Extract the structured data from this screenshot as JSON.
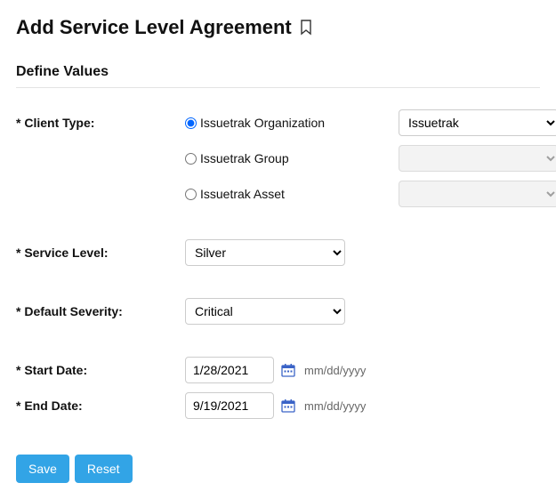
{
  "page": {
    "title": "Add Service Level Agreement"
  },
  "section": {
    "title": "Define Values"
  },
  "labels": {
    "client_type": "* Client Type:",
    "service_level": "* Service Level:",
    "default_severity": "* Default Severity:",
    "start_date": "* Start Date:",
    "end_date": "* End Date:"
  },
  "client_type": {
    "options": {
      "org": "Issuetrak Organization",
      "group": "Issuetrak Group",
      "asset": "Issuetrak Asset"
    },
    "org_select_value": "Issuetrak",
    "group_select_value": "",
    "asset_select_value": ""
  },
  "service_level": {
    "value": "Silver"
  },
  "default_severity": {
    "value": "Critical"
  },
  "dates": {
    "start": "1/28/2021",
    "end": "9/19/2021",
    "format_hint": "mm/dd/yyyy"
  },
  "buttons": {
    "save": "Save",
    "reset": "Reset"
  }
}
